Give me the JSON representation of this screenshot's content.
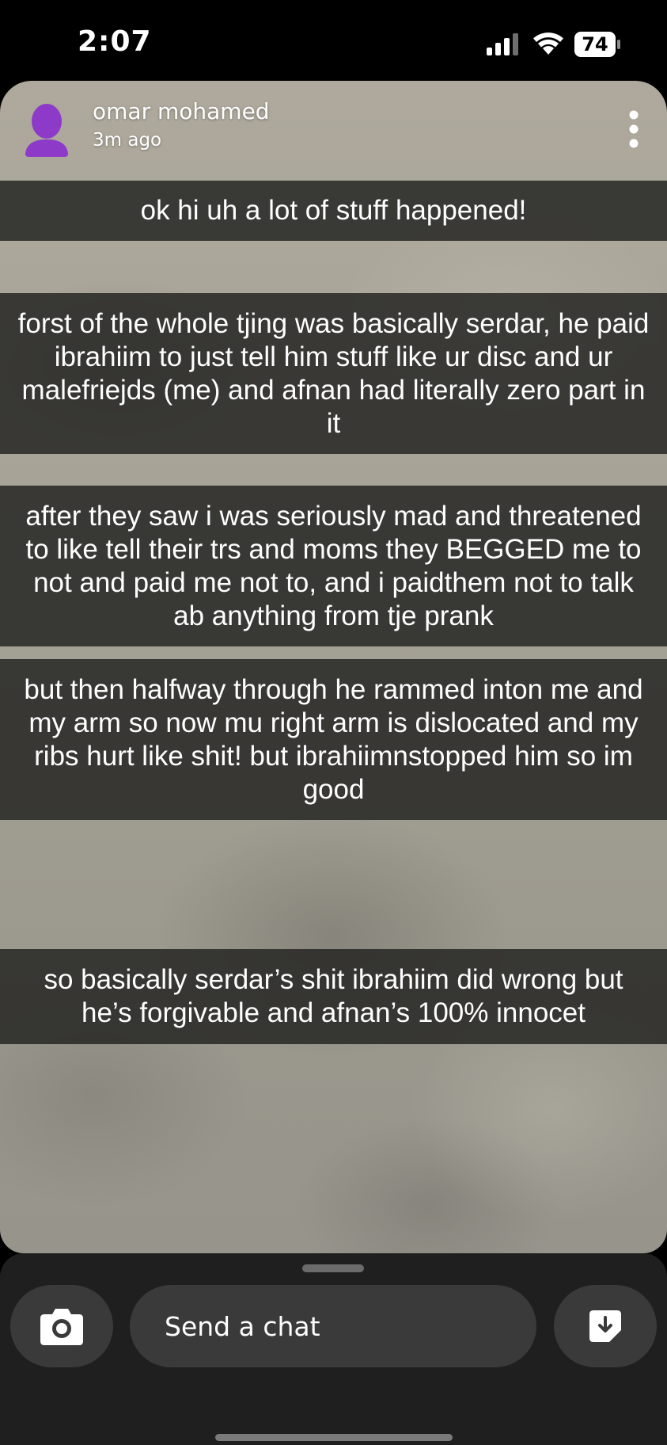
{
  "status_bar": {
    "time": "2:07",
    "battery": "74",
    "icons": [
      "signal-icon",
      "wifi-icon",
      "battery-icon"
    ]
  },
  "snap": {
    "sender_name": "omar mohamed",
    "time_ago": "3m ago",
    "icons": [
      "avatar-icon",
      "more-icon"
    ],
    "captions": [
      "ok hi uh a lot of stuff happened!",
      "forst of the whole tjing was basically serdar, he paid ibrahiim to just tell him stuff like ur disc and ur malefriejds (me) and afnan had literally zero part in it",
      "after they saw i was seriously mad and threatened to like tell their trs and moms they BEGGED me to not and paid me not to, and i paidthem not to talk ab anything from tje prank",
      "but then halfway through he rammed inton me and my arm so now mu right arm is dislocated and my ribs hurt like shit! but ibrahiimnstopped him so im good",
      "so basically serdar’s shit ibrahiim did wrong but he’s forgivable and afnan’s 100% innocet"
    ]
  },
  "chat_bar": {
    "placeholder": "Send a chat",
    "icons": [
      "camera-icon",
      "sticker-icon"
    ]
  },
  "colors": {
    "avatar": "#8e3ac9",
    "caption_bg": "#262624",
    "chat_bar_bg": "#1f1f1f",
    "pill_bg": "#3a3a3a"
  }
}
